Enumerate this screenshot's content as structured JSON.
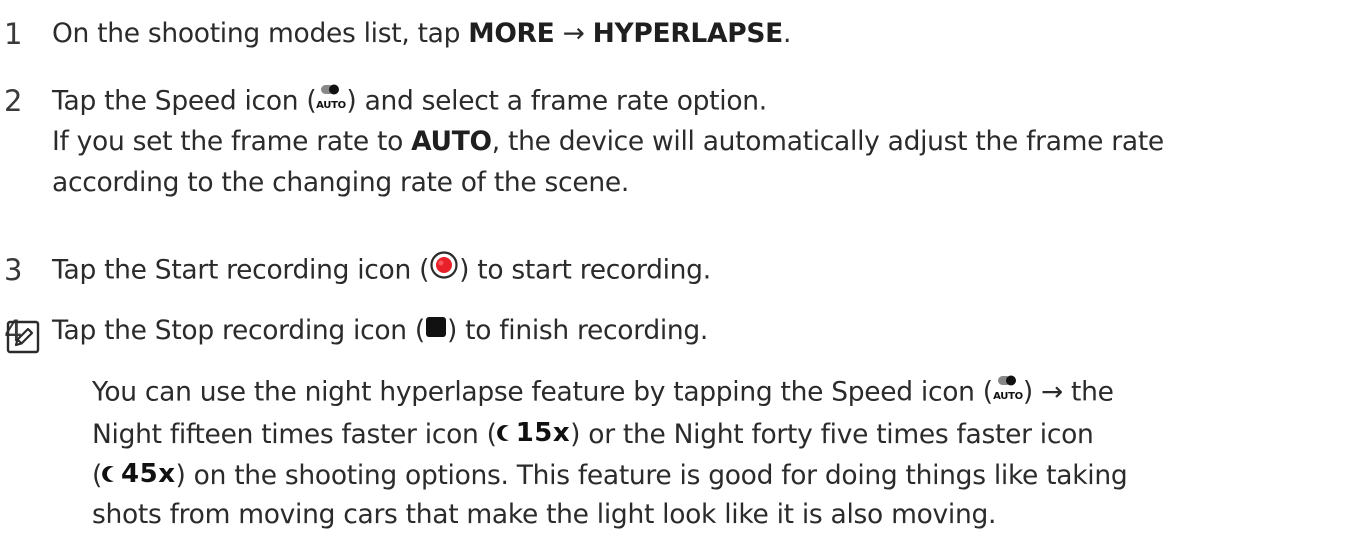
{
  "steps": [
    {
      "number": "1",
      "text_a": "On the shooting modes list, tap ",
      "bold_a": "MORE",
      "arrow": " → ",
      "bold_b": "HYPERLAPSE",
      "text_b": "."
    },
    {
      "number": "2",
      "text_a": "Tap the Speed icon (",
      "text_b": ") and select a frame rate option.",
      "sub_a": "If you set the frame rate to ",
      "sub_bold": "AUTO",
      "sub_b": ", the device will automatically adjust the frame rate",
      "sub_c": "according to the changing rate of the scene."
    },
    {
      "number": "3",
      "text_a": "Tap the Start recording icon (",
      "text_b": ") to start recording."
    },
    {
      "number": "4",
      "text_a": "Tap the Stop recording icon (",
      "text_b": ") to finish recording."
    }
  ],
  "note": {
    "line1_a": "You can use the night hyperlapse feature by tapping the Speed icon (",
    "line1_b": ") → the",
    "line2_a": "Night fifteen times faster icon (",
    "line2_b": ") or the Night forty five times faster icon",
    "line3_a": "(",
    "line3_b": ") on the shooting options. This feature is good for doing things like taking",
    "line4": "shots from moving cars that make the light look like it is also moving.",
    "badge_15": "15x",
    "badge_45": "45x"
  },
  "icons": {
    "speed_label": "AUTO",
    "speed": "speed-auto-icon",
    "record": "start-recording-icon",
    "stop": "stop-recording-icon",
    "note": "note-pencil-icon",
    "night": "night-moon-icon"
  },
  "colors": {
    "record_red": "#e8202a",
    "text": "#2b2b2b"
  }
}
